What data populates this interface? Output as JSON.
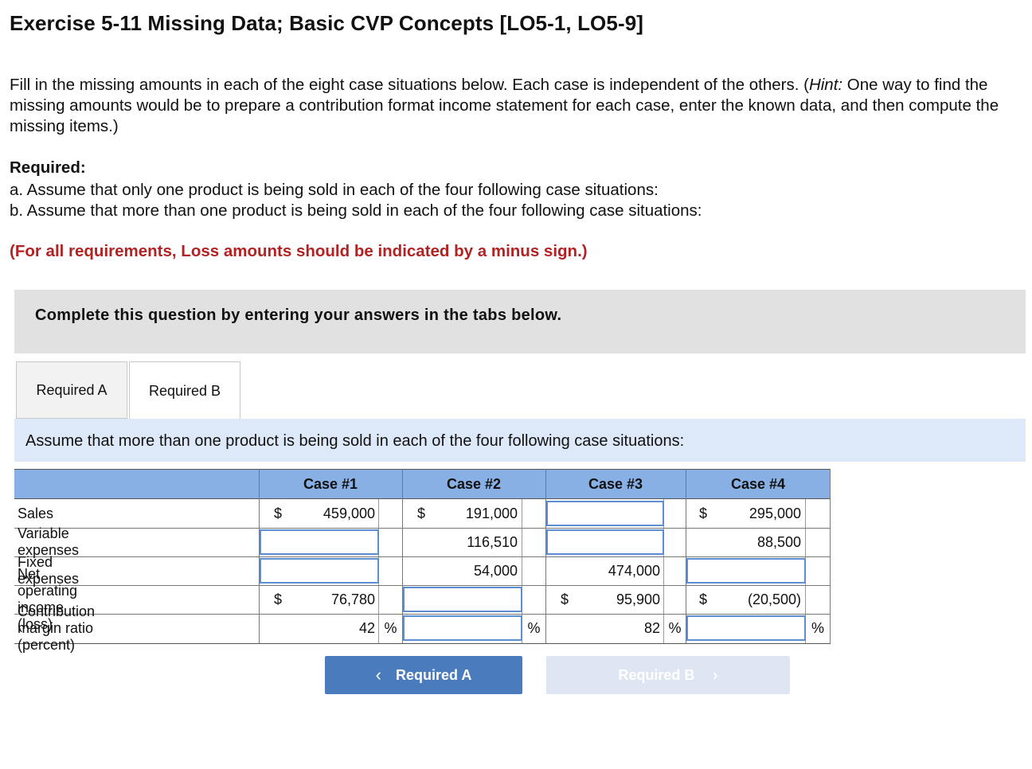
{
  "title": "Exercise 5-11 Missing Data; Basic CVP Concepts [LO5-1, LO5-9]",
  "intro": {
    "before_hint": "Fill in the missing amounts in each of the eight case situations below. Each case is independent of the others. (",
    "hint_label": "Hint:",
    "after_hint": " One way to find the missing amounts would be to prepare a contribution format income statement for each case, enter the known data, and then compute the missing items.)"
  },
  "required": {
    "heading": "Required:",
    "a": "a. Assume that only one product is being sold in each of the four following case situations:",
    "b": "b. Assume that more than one product is being sold in each of the four following case situations:"
  },
  "note": "(For all requirements, Loss amounts should be indicated by a minus sign.)",
  "banner": "Complete this question by entering your answers in the tabs below.",
  "tabs": [
    "Required A",
    "Required B"
  ],
  "subheading": "Assume that more than one product is being sold in each of the four following case situations:",
  "table": {
    "headers": [
      "Case #1",
      "Case #2",
      "Case #3",
      "Case #4"
    ],
    "currency_symbol": "$",
    "percent_symbol": "%",
    "rows": [
      {
        "label": "Sales",
        "c1": "459,000",
        "c2": "191,000",
        "c3": "",
        "c4": "295,000"
      },
      {
        "label": "Variable expenses",
        "c1": "",
        "c2": "116,510",
        "c3": "",
        "c4": "88,500"
      },
      {
        "label": "Fixed expenses",
        "c1": "",
        "c2": "54,000",
        "c3": "474,000",
        "c4": ""
      },
      {
        "label": "Net operating income (loss)",
        "c1": "76,780",
        "c2": "",
        "c3": "95,900",
        "c4": "(20,500)"
      },
      {
        "label": "Contribution margin ratio (percent)",
        "c1": "42",
        "c2": "",
        "c3": "82",
        "c4": ""
      }
    ]
  },
  "nav": {
    "prev": "Required A",
    "next": "Required B"
  }
}
